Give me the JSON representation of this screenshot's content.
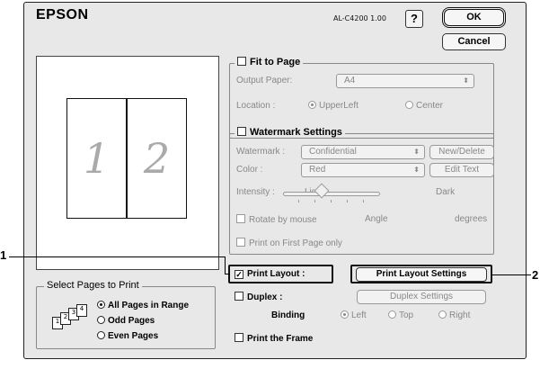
{
  "header": {
    "logo": "EPSON",
    "version": "AL-C4200 1.00",
    "help": "?",
    "ok": "OK",
    "cancel": "Cancel"
  },
  "preview": {
    "page1": "1",
    "page2": "2"
  },
  "fit_to_page": {
    "title": "Fit to Page",
    "output_paper_label": "Output Paper:",
    "output_paper_value": "A4",
    "location_label": "Location :",
    "upper_left": "UpperLeft",
    "center": "Center",
    "location_selected": "UpperLeft"
  },
  "watermark": {
    "title": "Watermark Settings",
    "watermark_label": "Watermark :",
    "watermark_value": "Confidential",
    "new_delete": "New/Delete",
    "color_label": "Color :",
    "color_value": "Red",
    "edit_text": "Edit Text",
    "intensity_label": "Intensity :",
    "light": "Light",
    "dark": "Dark",
    "rotate": "Rotate by mouse",
    "angle": "Angle",
    "degrees": "degrees",
    "first_page": "Print on First Page only"
  },
  "layout": {
    "print_layout": "Print Layout :",
    "print_layout_checked": true,
    "print_layout_settings": "Print Layout Settings",
    "duplex": "Duplex :",
    "duplex_settings": "Duplex Settings",
    "binding": "Binding",
    "left": "Left",
    "top": "Top",
    "right": "Right",
    "print_frame": "Print the Frame"
  },
  "pages": {
    "title": "Select Pages to Print",
    "all": "All Pages in Range",
    "odd": "Odd Pages",
    "even": "Even Pages",
    "selected": "All Pages in Range",
    "icon_numbers": [
      "1",
      "2",
      "3",
      "4"
    ]
  },
  "callouts": {
    "one": "1",
    "two": "2"
  }
}
